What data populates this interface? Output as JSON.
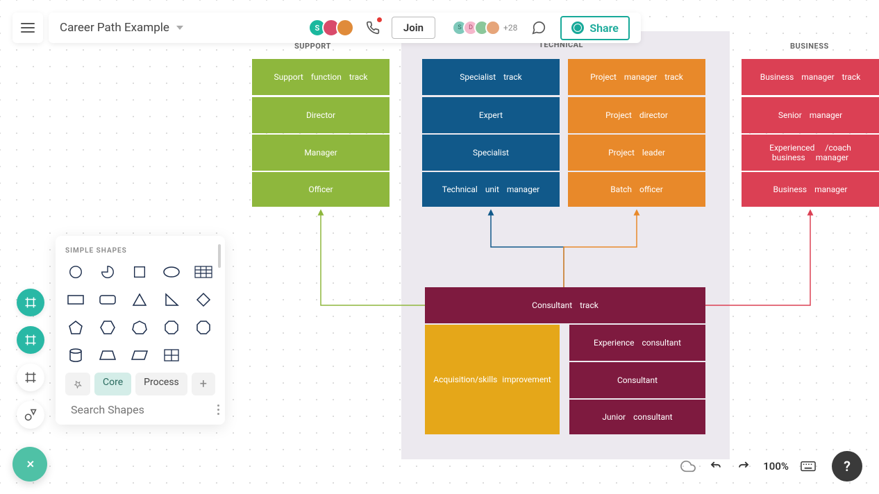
{
  "header": {
    "title": "Career Path Example",
    "join": "Join",
    "share": "Share",
    "more_count": "+28",
    "avatars": [
      {
        "letter": "S",
        "bg": "#1bb89e"
      },
      {
        "letter": "",
        "bg": "#d94a6a"
      },
      {
        "letter": "",
        "bg": "#e08b3a"
      }
    ],
    "mini_avatars": [
      {
        "letter": "S",
        "bg": "#c9e8e2"
      },
      {
        "letter": "D",
        "bg": "#f5b6cb"
      },
      {
        "letter": "",
        "bg": "#8bc79a"
      },
      {
        "letter": "",
        "bg": "#e6a57a"
      }
    ]
  },
  "columns": {
    "support": {
      "label": "SUPPORT"
    },
    "technical": {
      "label": "TECHNICAL"
    },
    "business": {
      "label": "BUSINESS"
    }
  },
  "blocks": {
    "s1": "Support function track",
    "s2": "Director",
    "s3": "Manager",
    "s4": "Officer",
    "t1": "Specialist track",
    "t2": "Expert",
    "t3": "Specialist",
    "t4": "Technical unit manager",
    "p1": "Project manager track",
    "p2": "Project director",
    "p3": "Project leader",
    "p4": "Batch officer",
    "b1": "Business manager track",
    "b2": "Senior manager",
    "b3": "Experienced /coach business manager",
    "b4": "Business manager",
    "c1": "Consultant track",
    "c2": "Acquisition/skills improvement",
    "c3": "Experience consultant",
    "c4": "Consultant",
    "c5": "Junior consultant"
  },
  "colors": {
    "green": "#8eb73d",
    "blue": "#11598a",
    "orange": "#e8892a",
    "red": "#db4054",
    "maroon": "#7e1a3f",
    "gold": "#e5a719"
  },
  "shapes": {
    "title": "SIMPLE SHAPES",
    "tabs": {
      "core": "Core",
      "process": "Process"
    },
    "search_placeholder": "Search Shapes"
  },
  "footer": {
    "zoom": "100%"
  }
}
